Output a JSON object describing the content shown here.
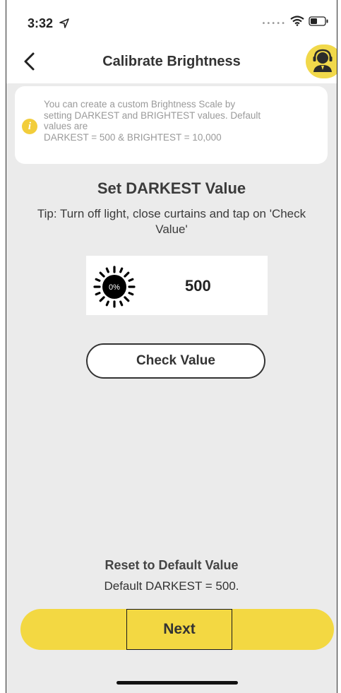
{
  "status": {
    "time": "3:32"
  },
  "nav": {
    "title": "Calibrate Brightness"
  },
  "info": {
    "lines": [
      "You can create a custom Brightness Scale by",
      "setting DARKEST and BRIGHTEST values. Default",
      "values are",
      "DARKEST = 500 &  BRIGHTEST = 10,000"
    ]
  },
  "section": {
    "title": "Set DARKEST Value",
    "tip": "Tip: Turn off light, close curtains and tap on 'Check Value'"
  },
  "reading": {
    "percent": "0%",
    "value": "500"
  },
  "buttons": {
    "check": "Check Value",
    "reset": "Reset to Default Value",
    "next": "Next"
  },
  "default_text": "Default DARKEST = 500.",
  "colors": {
    "accent": "#f3d842",
    "background": "#ebebeb"
  }
}
